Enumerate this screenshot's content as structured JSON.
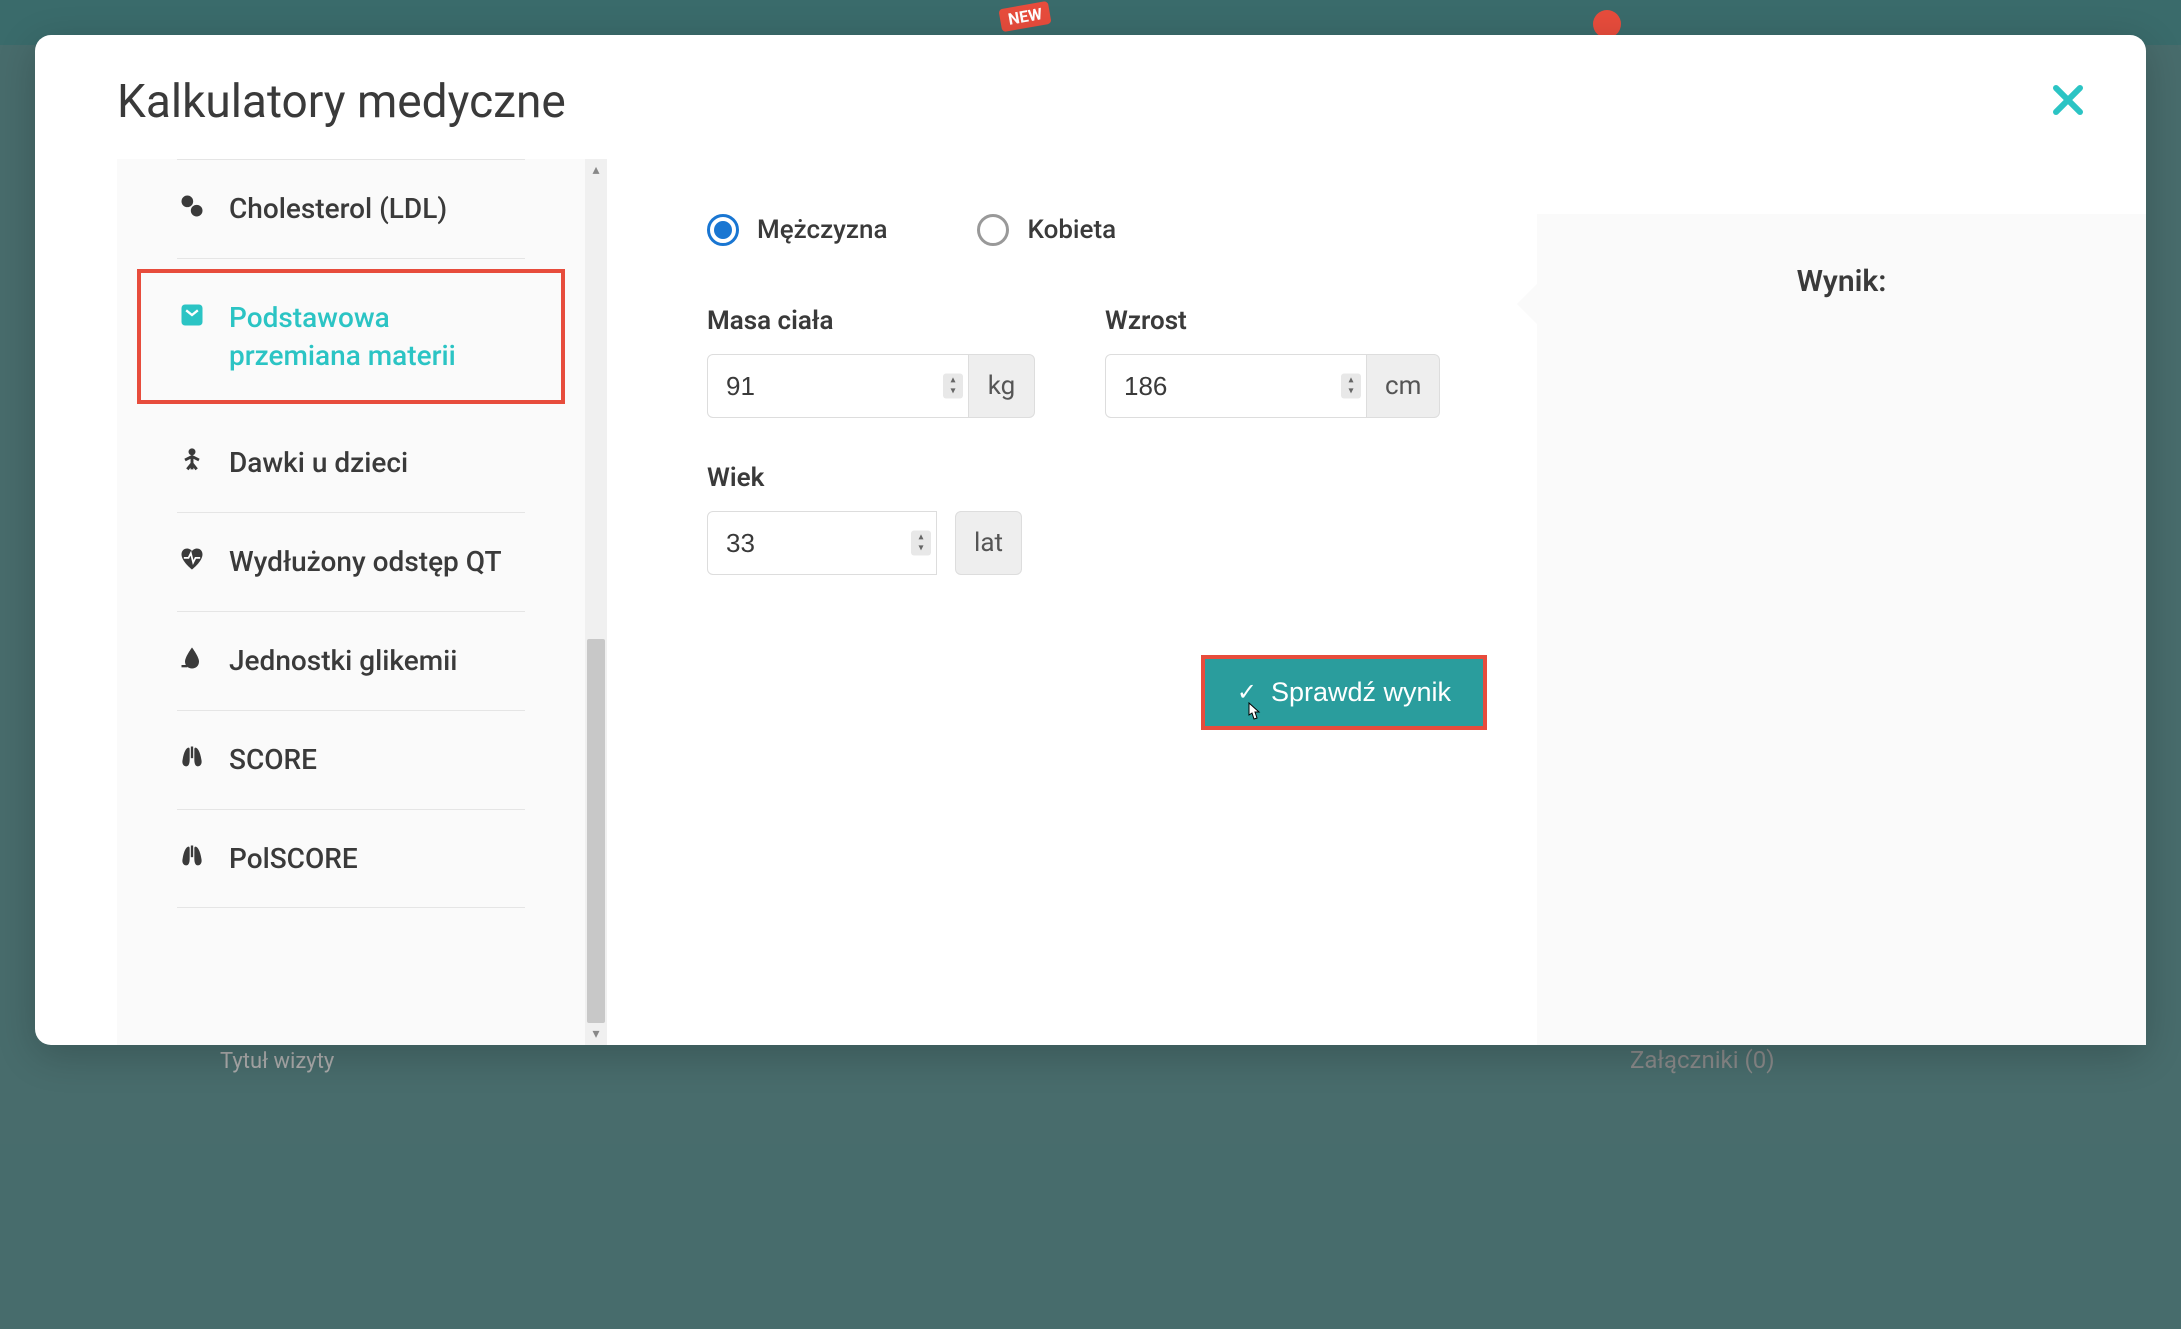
{
  "background": {
    "new_badge": "NEW",
    "zalaczniki": "Załączniki (0)",
    "tytul": "Tytuł wizyty"
  },
  "modal": {
    "title": "Kalkulatory medyczne"
  },
  "sidebar": {
    "items": [
      {
        "label": "Cholesterol (LDL)",
        "icon": "pills"
      },
      {
        "label": "Podstawowa przemiana materii",
        "icon": "scale",
        "selected": true
      },
      {
        "label": "Dawki u dzieci",
        "icon": "child"
      },
      {
        "label": "Wydłużony odstęp QT",
        "icon": "heartbeat"
      },
      {
        "label": "Jednostki glikemii",
        "icon": "drop"
      },
      {
        "label": "SCORE",
        "icon": "lungs"
      },
      {
        "label": "PolSCORE",
        "icon": "lungs"
      }
    ]
  },
  "form": {
    "gender": {
      "male": "Mężczyzna",
      "female": "Kobieta",
      "selected": "male"
    },
    "mass": {
      "label": "Masa ciała",
      "value": "91",
      "unit": "kg"
    },
    "height": {
      "label": "Wzrost",
      "value": "186",
      "unit": "cm"
    },
    "age": {
      "label": "Wiek",
      "value": "33",
      "unit": "lat"
    },
    "submit": "Sprawdź wynik"
  },
  "result": {
    "title": "Wynik:"
  }
}
